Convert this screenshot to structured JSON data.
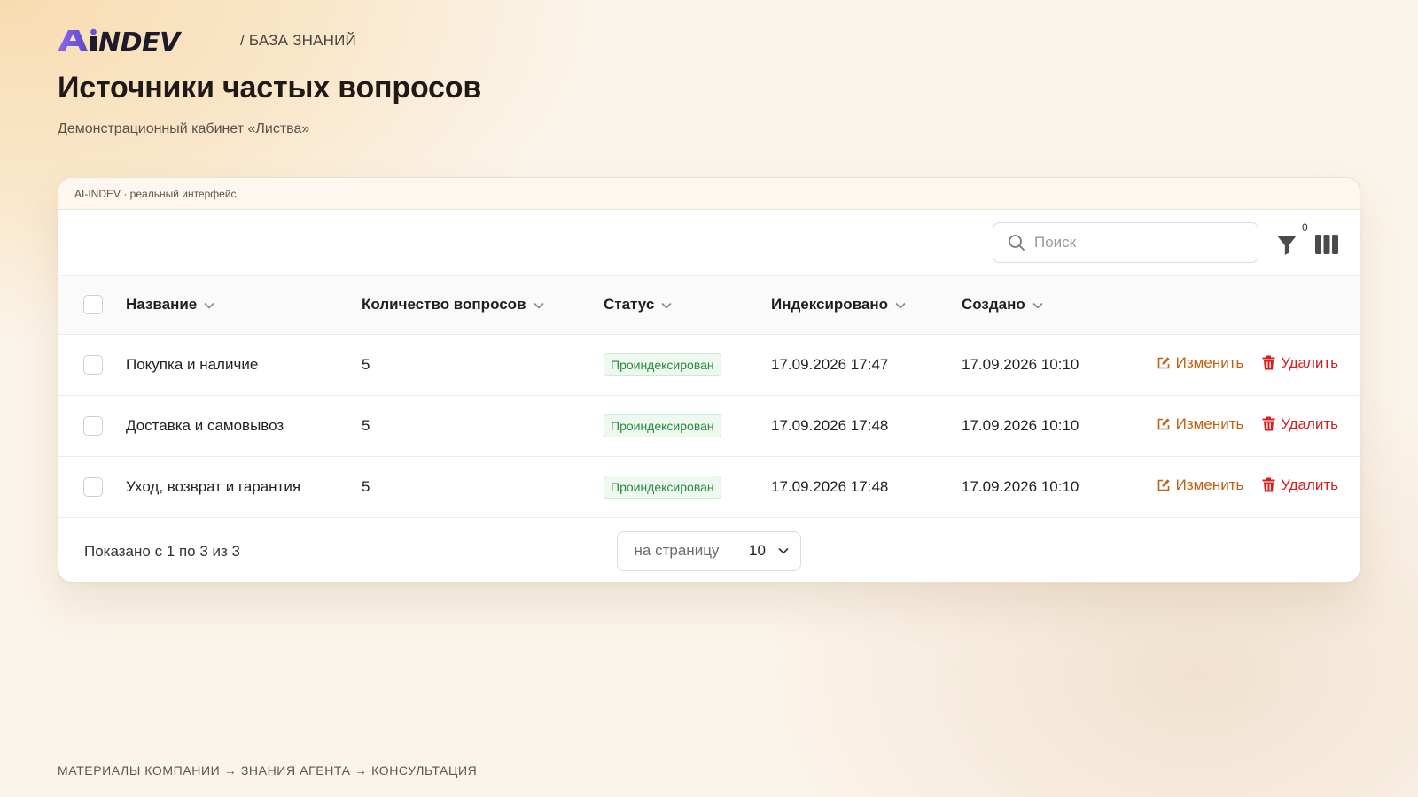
{
  "brand": {
    "logo_text": "AiNDEV",
    "crumb": "/ БАЗА ЗНАНИЙ"
  },
  "page": {
    "title": "Источники частых вопросов",
    "subtitle": "Демонстрационный кабинет «Листва»"
  },
  "card": {
    "strip_label": "AI-INDEV · реальный интерфейс"
  },
  "toolbar": {
    "search_placeholder": "Поиск",
    "filter_count": "0"
  },
  "table": {
    "columns": [
      "Название",
      "Количество вопросов",
      "Статус",
      "Индексировано",
      "Создано"
    ],
    "rows": [
      {
        "name": "Покупка и наличие",
        "count": "5",
        "status": "Проиндексирован",
        "indexed": "17.09.2026 17:47",
        "created": "17.09.2026 10:10"
      },
      {
        "name": "Доставка и самовывоз",
        "count": "5",
        "status": "Проиндексирован",
        "indexed": "17.09.2026 17:48",
        "created": "17.09.2026 10:10"
      },
      {
        "name": "Уход, возврат и гарантия",
        "count": "5",
        "status": "Проиндексирован",
        "indexed": "17.09.2026 17:48",
        "created": "17.09.2026 10:10"
      }
    ],
    "edit_label": "Изменить",
    "delete_label": "Удалить"
  },
  "footer": {
    "shown": "Показано с 1 по 3 из 3",
    "per_page_label": "на страницу",
    "per_page_value": "10"
  },
  "bottom_flow": "МАТЕРИАЛЫ КОМПАНИИ → ЗНАНИЯ АГЕНТА → КОНСУЛЬТАЦИЯ",
  "colors": {
    "accent_edit": "#c2600f",
    "accent_delete": "#d61f1f",
    "status_green": "#2b8a3e",
    "logo_purple": "#6a4fd8",
    "logo_dark": "#1c1a2b"
  }
}
